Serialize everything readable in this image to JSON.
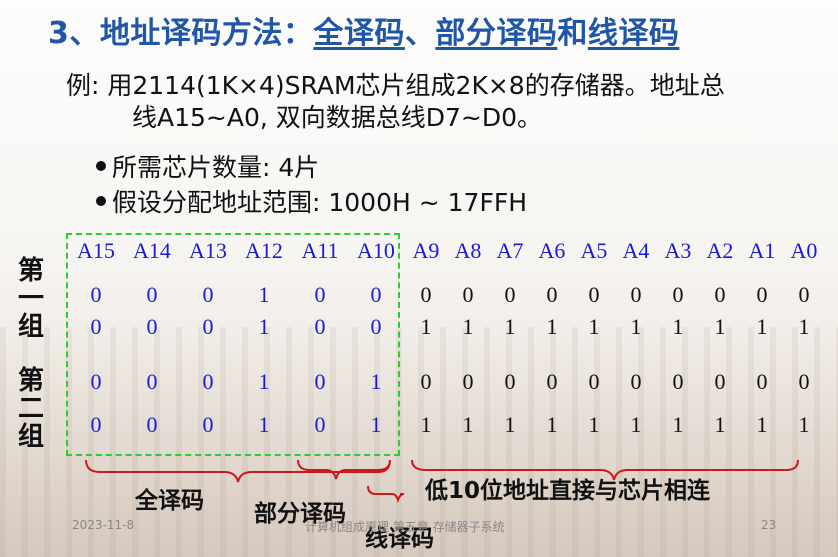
{
  "title": {
    "prefix": "3、地址译码方法：",
    "full": "全译码",
    "sep": "、",
    "partial": "部分译码",
    "and": "和",
    "line": "线译码"
  },
  "example": {
    "line1": "例:  用2114(1K×4)SRAM芯片组成2K×8的存储器。地址总",
    "line2": "线A15~A0, 双向数据总线D7~D0。"
  },
  "bullets": [
    "所需芯片数量: 4片",
    "假设分配地址范围: 1000H  ~  17FFH"
  ],
  "table": {
    "headers": [
      "A15",
      "A14",
      "A13",
      "A12",
      "A11",
      "A10",
      "A9",
      "A8",
      "A7",
      "A6",
      "A5",
      "A4",
      "A3",
      "A2",
      "A1",
      "A0"
    ],
    "rows": [
      [
        "0",
        "0",
        "0",
        "1",
        "0",
        "0",
        "0",
        "0",
        "0",
        "0",
        "0",
        "0",
        "0",
        "0",
        "0",
        "0"
      ],
      [
        "0",
        "0",
        "0",
        "1",
        "0",
        "0",
        "1",
        "1",
        "1",
        "1",
        "1",
        "1",
        "1",
        "1",
        "1",
        "1"
      ],
      [
        "0",
        "0",
        "0",
        "1",
        "0",
        "1",
        "0",
        "0",
        "0",
        "0",
        "0",
        "0",
        "0",
        "0",
        "0",
        "0"
      ],
      [
        "0",
        "0",
        "0",
        "1",
        "0",
        "1",
        "1",
        "1",
        "1",
        "1",
        "1",
        "1",
        "1",
        "1",
        "1",
        "1"
      ]
    ]
  },
  "groups": {
    "first": [
      "第",
      "一",
      "组"
    ],
    "second": [
      "第",
      "二",
      "组"
    ]
  },
  "labels": {
    "full": "全译码",
    "partial": "部分译码",
    "line": "线译码",
    "low10": "低10位地址直接与芯片相连"
  },
  "footer": {
    "date": "2023-11-8",
    "course": "计算机组成原理 第五章 存储器子系统",
    "page": "23"
  },
  "colors": {
    "title": "#1f56a8",
    "header_digits": "#1a1ad6",
    "dash_box": "#2ecc2e",
    "brace": "#cc1a1a"
  }
}
